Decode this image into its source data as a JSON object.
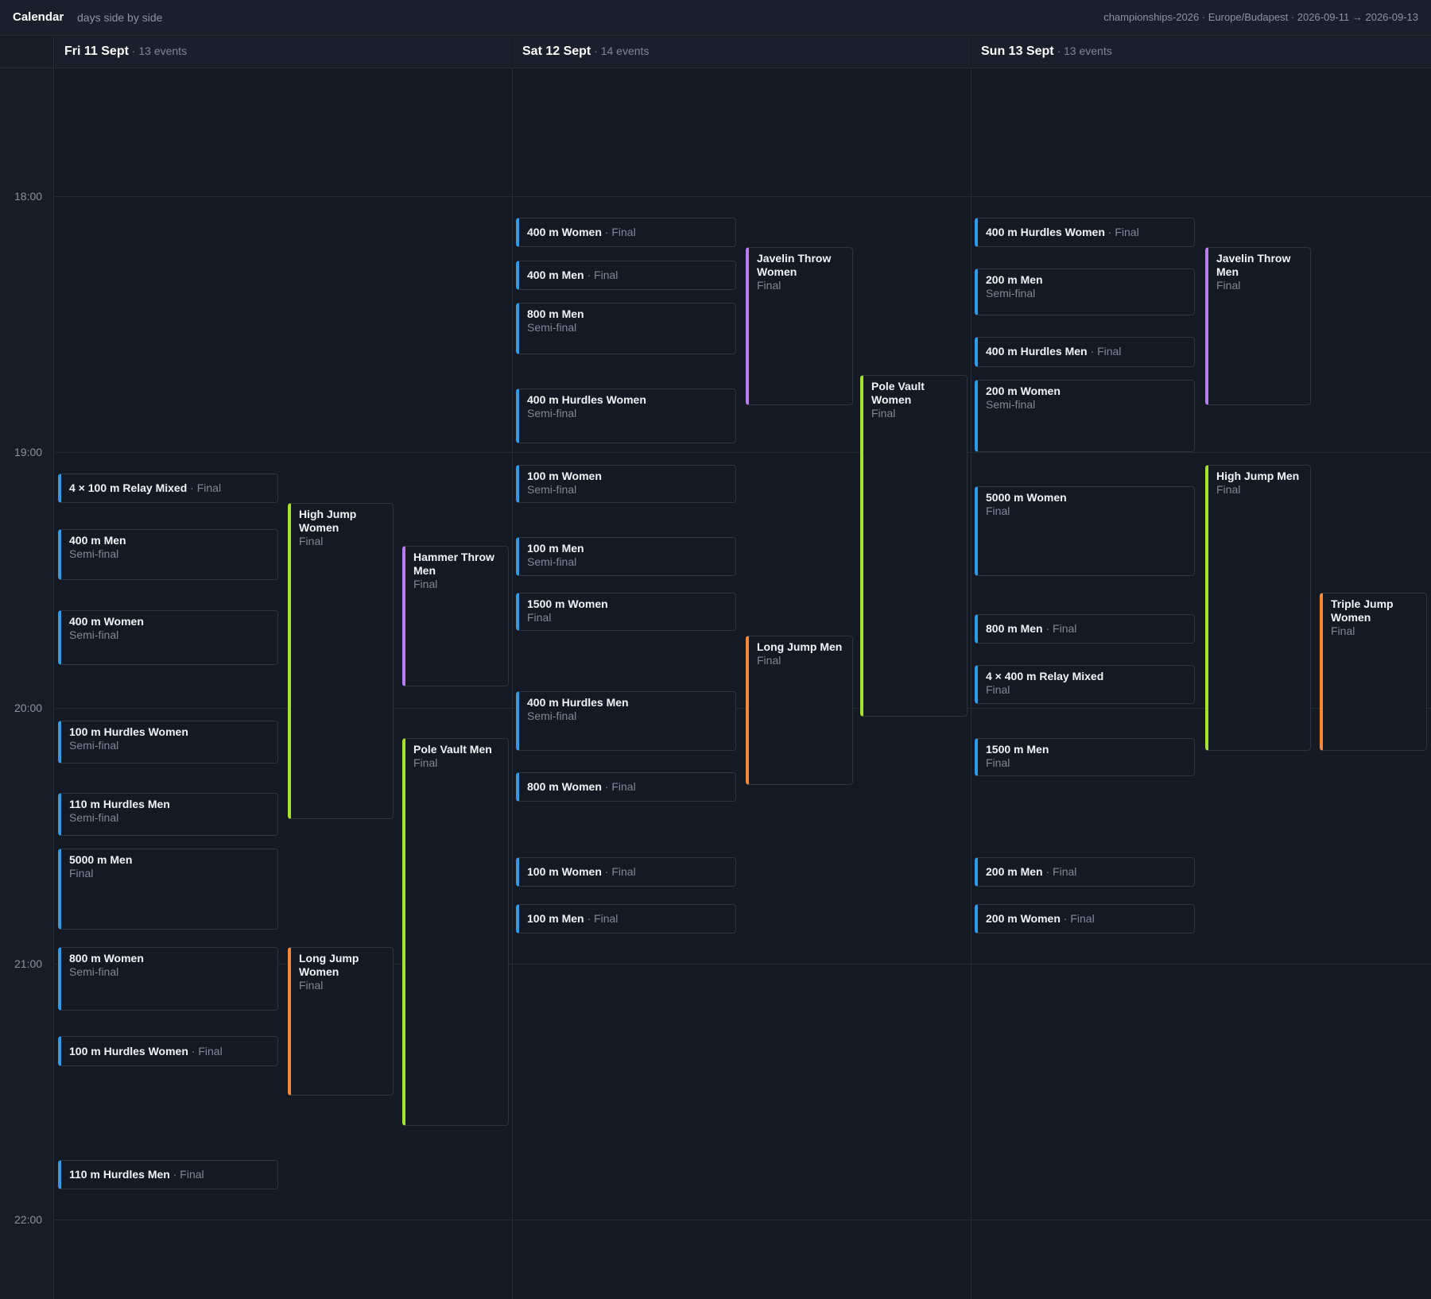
{
  "header": {
    "title": "Calendar",
    "subtitle": "days side by side",
    "meta": "championships-2026 · Europe/Budapest · 2026-09-11 → 2026-09-13"
  },
  "time_labels": [
    "18:00",
    "19:00",
    "20:00",
    "21:00",
    "22:00"
  ],
  "days": [
    {
      "label": "Fri 11 Sept",
      "count": " · 13 events"
    },
    {
      "label": "Sat 12 Sept",
      "count": " · 14 events"
    },
    {
      "label": "Sun 13 Sept",
      "count": " · 13 events"
    }
  ],
  "colors": {
    "track": "#2e9be6",
    "jump_high": "#a6e22e",
    "throw": "#b77cf0",
    "jump_long": "#f5883a"
  },
  "events": [
    {
      "day": 0,
      "title": "4 × 100 m Relay Mixed",
      "stage": "Final",
      "color": "track",
      "start": "19:05",
      "end": "19:12"
    },
    {
      "day": 0,
      "title": "400 m Men",
      "stage": "Semi-final",
      "color": "track",
      "start": "19:18",
      "end": "19:30"
    },
    {
      "day": 0,
      "title": "400 m Women",
      "stage": "Semi-final",
      "color": "track",
      "start": "19:37",
      "end": "19:50"
    },
    {
      "day": 0,
      "title": "100 m Hurdles Women",
      "stage": "Semi-final",
      "color": "track",
      "start": "20:03",
      "end": "20:13"
    },
    {
      "day": 0,
      "title": "110 m Hurdles Men",
      "stage": "Semi-final",
      "color": "track",
      "start": "20:20",
      "end": "20:30"
    },
    {
      "day": 0,
      "title": "5000 m Men",
      "stage": "Final",
      "color": "track",
      "start": "20:33",
      "end": "20:52"
    },
    {
      "day": 0,
      "title": "800 m Women",
      "stage": "Semi-final",
      "color": "track",
      "start": "20:56",
      "end": "21:11"
    },
    {
      "day": 0,
      "title": "100 m Hurdles Women",
      "stage": "Final",
      "color": "track",
      "start": "21:17",
      "end": "21:24"
    },
    {
      "day": 0,
      "title": "110 m Hurdles Men",
      "stage": "Final",
      "color": "track",
      "start": "21:46",
      "end": "21:53"
    },
    {
      "day": 0,
      "title": "High Jump Women",
      "stage": "Final",
      "color": "jump_high",
      "start": "19:12",
      "end": "20:26"
    },
    {
      "day": 0,
      "title": "Long Jump Women",
      "stage": "Final",
      "color": "jump_long",
      "start": "20:56",
      "end": "21:31"
    },
    {
      "day": 0,
      "title": "Hammer Throw Men",
      "stage": "Final",
      "color": "throw",
      "start": "19:22",
      "end": "19:55"
    },
    {
      "day": 0,
      "title": "Pole Vault Men",
      "stage": "Final",
      "color": "jump_high",
      "start": "20:07",
      "end": "21:38"
    },
    {
      "day": 1,
      "title": "400 m Women",
      "stage": "Final",
      "color": "track",
      "start": "18:05",
      "end": "18:12"
    },
    {
      "day": 1,
      "title": "400 m Men",
      "stage": "Final",
      "color": "track",
      "start": "18:15",
      "end": "18:22"
    },
    {
      "day": 1,
      "title": "800 m Men",
      "stage": "Semi-final",
      "color": "track",
      "start": "18:25",
      "end": "18:37"
    },
    {
      "day": 1,
      "title": "400 m Hurdles Women",
      "stage": "Semi-final",
      "color": "track",
      "start": "18:45",
      "end": "18:58"
    },
    {
      "day": 1,
      "title": "100 m Women",
      "stage": "Semi-final",
      "color": "track",
      "start": "19:03",
      "end": "19:12"
    },
    {
      "day": 1,
      "title": "100 m Men",
      "stage": "Semi-final",
      "color": "track",
      "start": "19:20",
      "end": "19:29"
    },
    {
      "day": 1,
      "title": "1500 m Women",
      "stage": "Final",
      "color": "track",
      "start": "19:33",
      "end": "19:42"
    },
    {
      "day": 1,
      "title": "400 m Hurdles Men",
      "stage": "Semi-final",
      "color": "track",
      "start": "19:56",
      "end": "20:10"
    },
    {
      "day": 1,
      "title": "800 m Women",
      "stage": "Final",
      "color": "track",
      "start": "20:15",
      "end": "20:22"
    },
    {
      "day": 1,
      "title": "100 m Women",
      "stage": "Final",
      "color": "track",
      "start": "20:35",
      "end": "20:42"
    },
    {
      "day": 1,
      "title": "100 m Men",
      "stage": "Final",
      "color": "track",
      "start": "20:46",
      "end": "20:53"
    },
    {
      "day": 1,
      "title": "Javelin Throw Women",
      "stage": "Final",
      "color": "throw",
      "start": "18:12",
      "end": "18:49"
    },
    {
      "day": 1,
      "title": "Long Jump Men",
      "stage": "Final",
      "color": "jump_long",
      "start": "19:43",
      "end": "20:18"
    },
    {
      "day": 1,
      "title": "Pole Vault Women",
      "stage": "Final",
      "color": "jump_high",
      "start": "18:42",
      "end": "20:02"
    },
    {
      "day": 2,
      "title": "400 m Hurdles Women",
      "stage": "Final",
      "color": "track",
      "start": "18:05",
      "end": "18:12"
    },
    {
      "day": 2,
      "title": "200 m Men",
      "stage": "Semi-final",
      "color": "track",
      "start": "18:17",
      "end": "18:28"
    },
    {
      "day": 2,
      "title": "400 m Hurdles Men",
      "stage": "Final",
      "color": "track",
      "start": "18:33",
      "end": "18:40"
    },
    {
      "day": 2,
      "title": "200 m Women",
      "stage": "Semi-final",
      "color": "track",
      "start": "18:43",
      "end": "19:00"
    },
    {
      "day": 2,
      "title": "5000 m Women",
      "stage": "Final",
      "color": "track",
      "start": "19:08",
      "end": "19:29"
    },
    {
      "day": 2,
      "title": "800 m Men",
      "stage": "Final",
      "color": "track",
      "start": "19:38",
      "end": "19:45"
    },
    {
      "day": 2,
      "title": "4 × 400 m Relay Mixed",
      "stage": "Final",
      "color": "track",
      "start": "19:50",
      "end": "19:59"
    },
    {
      "day": 2,
      "title": "1500 m Men",
      "stage": "Final",
      "color": "track",
      "start": "20:07",
      "end": "20:16"
    },
    {
      "day": 2,
      "title": "200 m Men",
      "stage": "Final",
      "color": "track",
      "start": "20:35",
      "end": "20:42"
    },
    {
      "day": 2,
      "title": "200 m Women",
      "stage": "Final",
      "color": "track",
      "start": "20:46",
      "end": "20:53"
    },
    {
      "day": 2,
      "title": "Javelin Throw Men",
      "stage": "Final",
      "color": "throw",
      "start": "18:12",
      "end": "18:49"
    },
    {
      "day": 2,
      "title": "High Jump Men",
      "stage": "Final",
      "color": "jump_high",
      "start": "19:03",
      "end": "20:10"
    },
    {
      "day": 2,
      "title": "Triple Jump Women",
      "stage": "Final",
      "color": "jump_long",
      "start": "19:33",
      "end": "20:10"
    }
  ]
}
